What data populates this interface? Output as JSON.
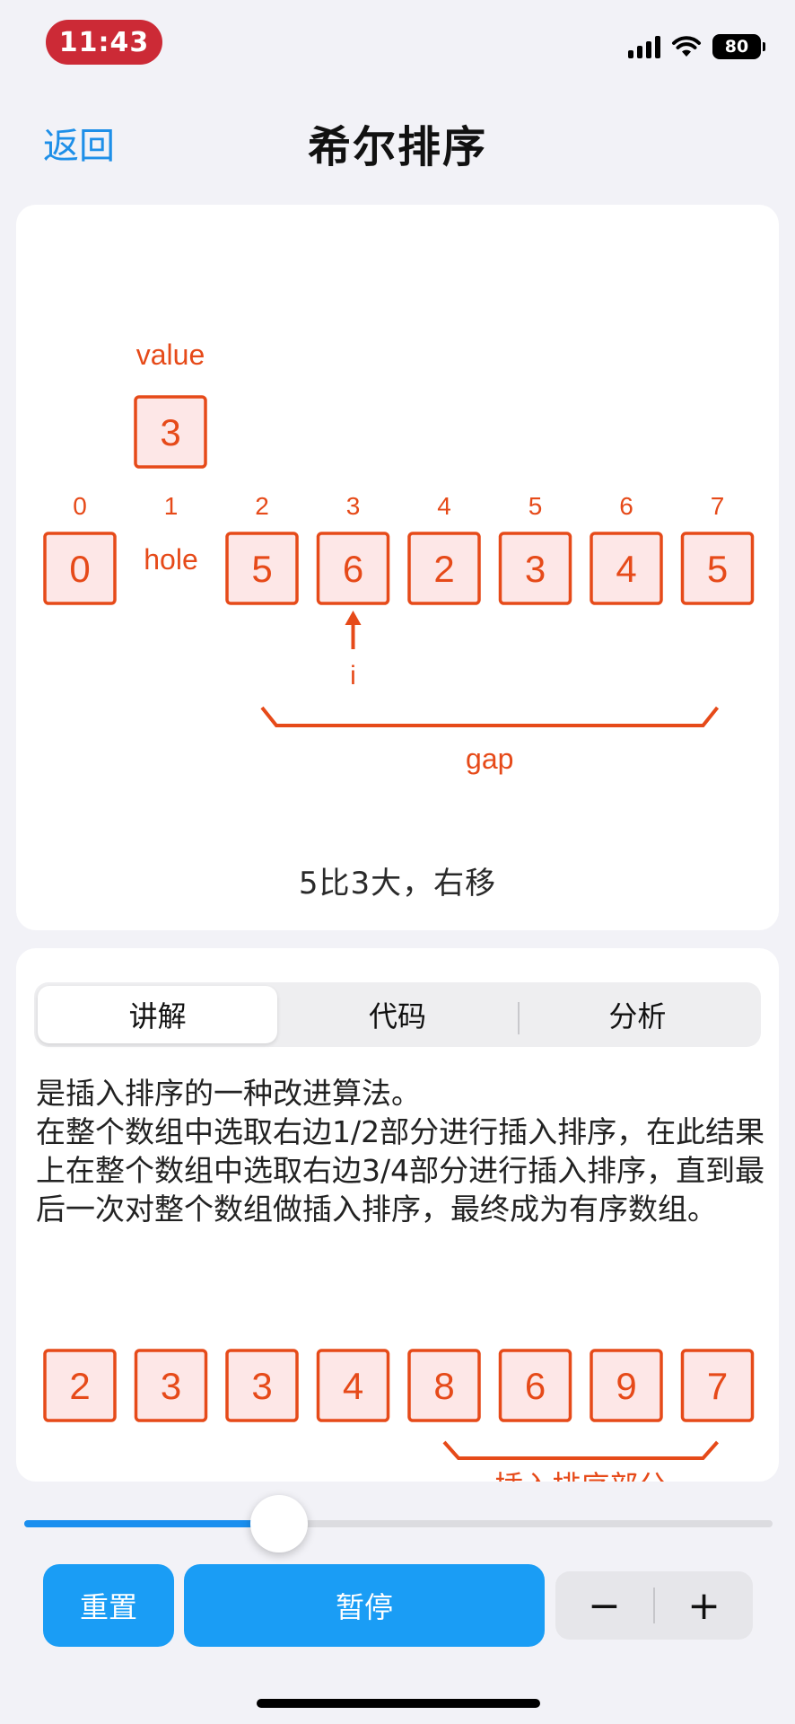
{
  "status_bar": {
    "time": "11:43",
    "battery": "80"
  },
  "nav": {
    "back_label": "返回",
    "title": "希尔排序"
  },
  "visualization": {
    "value_label": "value",
    "value": "3",
    "indices": [
      "0",
      "1",
      "2",
      "3",
      "4",
      "5",
      "6",
      "7"
    ],
    "cells": [
      "0",
      "hole",
      "5",
      "6",
      "2",
      "3",
      "4",
      "5"
    ],
    "pointer_label": "i",
    "gap_label": "gap",
    "caption": "5比3大，右移",
    "accent_color": "#e64a19",
    "cell_fill": "#fde7e7"
  },
  "tabs": [
    {
      "label": "讲解",
      "active": true
    },
    {
      "label": "代码",
      "active": false
    },
    {
      "label": "分析",
      "active": false
    }
  ],
  "explanation": {
    "text": "是插入排序的一种改进算法。\n在整个数组中选取右边1/2部分进行插入排序，在此结果上在整个数组中选取右边3/4部分进行插入排序，直到最后一次对整个数组做插入排序，最终成为有序数组。",
    "example_cells": [
      "2",
      "3",
      "3",
      "4",
      "8",
      "6",
      "9",
      "7"
    ],
    "example_brace_label": "插入排序部分"
  },
  "slider": {
    "progress": 0.34,
    "fill_color": "#1a8fef"
  },
  "controls": {
    "reset_label": "重置",
    "pause_label": "暂停",
    "minus_label": "−",
    "plus_label": "+"
  }
}
